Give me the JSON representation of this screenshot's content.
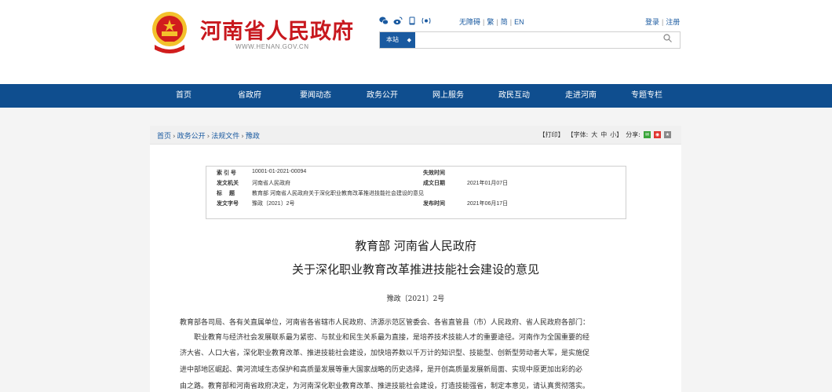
{
  "header": {
    "site_title": "河南省人民政府",
    "site_url": "WWW.HENAN.GOV.CN",
    "social_icons": [
      "wechat-icon",
      "weibo-icon",
      "mobile-icon",
      "app-icon"
    ],
    "links": {
      "accessibility": "无障碍",
      "traditional": "繁",
      "simplified": "简",
      "english": "EN"
    },
    "login": "登录",
    "register": "注册",
    "search": {
      "scope": "本站",
      "placeholder": ""
    }
  },
  "nav": {
    "items": [
      "首页",
      "省政府",
      "要闻动态",
      "政务公开",
      "网上服务",
      "政民互动",
      "走进河南",
      "专题专栏"
    ]
  },
  "breadcrumb": {
    "items": [
      "首页",
      "政务公开",
      "法规文件",
      "豫政"
    ]
  },
  "tools": {
    "print": "【打印】",
    "font_label": "【字体:",
    "font_large": "大",
    "font_medium": "中",
    "font_small": "小】",
    "share_label": "分享:"
  },
  "meta": {
    "index_label": "索 引 号",
    "index_value": "10001-01-2021-00094",
    "expire_label": "失效时间",
    "expire_value": "",
    "issuer_label": "发文机关",
    "issuer_value": "河南省人民政府",
    "created_label": "成文日期",
    "created_value": "2021年01月07日",
    "title_label": "标　 题",
    "title_value": "教育部 河南省人民政府关于深化职业教育改革推进技能社会建设的意见",
    "docno_label": "发文字号",
    "docno_value": "豫政〔2021〕2号",
    "published_label": "发布时间",
    "published_value": "2021年06月17日"
  },
  "document": {
    "title_line1": "教育部  河南省人民政府",
    "title_line2": "关于深化职业教育改革推进技能社会建设的意见",
    "doc_number": "豫政〔2021〕2号",
    "addressee": "教育部各司局、各有关直属单位，河南省各省辖市人民政府、济源示范区管委会、各省直管县（市）人民政府、省人民政府各部门：",
    "p1_l1": "职业教育与经济社会发展联系最为紧密、与就业和民生关系最为直接，是培养技术技能人才的重要途径。河南作为全国重要的经",
    "p1_l2": "济大省、人口大省，深化职业教育改革、推进技能社会建设，加快培养数以千万计的知识型、技能型、创新型劳动者大军，是实施促",
    "p1_l3": "进中部地区崛起、黄河流域生态保护和高质量发展等重大国家战略的历史选择，是开创高质量发展新局面、实现中原更加出彩的必",
    "p1_l4": "由之路。教育部和河南省政府决定，为河南深化职业教育改革、推进技能社会建设，打造技能强省，制定本意见，请认真贯彻落实。"
  }
}
